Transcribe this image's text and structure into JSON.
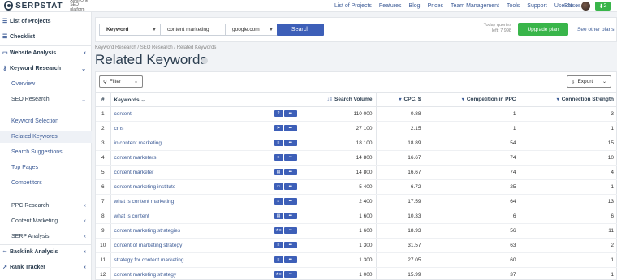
{
  "topbar": {
    "logo": "SERPSTAT",
    "tagline": "All-in-One SEO platform",
    "nav": [
      "List of Projects",
      "Features",
      "Blog",
      "Prices",
      "Team Management",
      "Tools",
      "Support",
      "Use cases"
    ],
    "lang": "EN",
    "notif_count": "2"
  },
  "sidebar": {
    "items": [
      {
        "label": "List of Projects",
        "icon": "list-icon"
      },
      {
        "label": "Checklist",
        "icon": "checklist-icon"
      },
      {
        "label": "Website Analysis",
        "icon": "website-icon"
      },
      {
        "label": "Keyword Research",
        "icon": "key-icon"
      },
      {
        "label": "Overview"
      },
      {
        "label": "SEO Research"
      },
      {
        "label": "Keyword Selection"
      },
      {
        "label": "Related Keywords"
      },
      {
        "label": "Search Suggestions"
      },
      {
        "label": "Top Pages"
      },
      {
        "label": "Competitors"
      },
      {
        "label": "PPC Research"
      },
      {
        "label": "Content Marketing"
      },
      {
        "label": "SERP Analysis"
      },
      {
        "label": "Backlink Analysis",
        "icon": "link-icon"
      },
      {
        "label": "Rank Tracker",
        "icon": "tracker-icon"
      }
    ]
  },
  "search": {
    "type": "Keyword",
    "query": "content marketing",
    "database": "google.com",
    "button": "Search",
    "queries_label": "Today queries",
    "queries_left": "left: 7 998",
    "upgrade": "Upgrade plan",
    "other_plans": "See other plans"
  },
  "page": {
    "breadcrumb": "Keyword Research / SEO Research / Related Keywords",
    "title": "Related Keywords"
  },
  "toolbar": {
    "filter": "Filter",
    "export": "Export"
  },
  "table": {
    "headers": {
      "num": "#",
      "keyword": "Keywords",
      "volume": "Search Volume",
      "cpc": "CPC, $",
      "competition": "Competition in PPC",
      "connection": "Connection Strength"
    },
    "rows": [
      {
        "n": "1",
        "kw": "content",
        "vol": "110 000",
        "cpc": "0.88",
        "comp": "1",
        "conn": "3"
      },
      {
        "n": "2",
        "kw": "cms",
        "vol": "27 100",
        "cpc": "2.15",
        "comp": "1",
        "conn": "1"
      },
      {
        "n": "3",
        "kw": "in content marketing",
        "vol": "18 100",
        "cpc": "18.89",
        "comp": "54",
        "conn": "15"
      },
      {
        "n": "4",
        "kw": "content marketers",
        "vol": "14 800",
        "cpc": "16.67",
        "comp": "74",
        "conn": "10"
      },
      {
        "n": "5",
        "kw": "content marketer",
        "vol": "14 800",
        "cpc": "16.67",
        "comp": "74",
        "conn": "4"
      },
      {
        "n": "6",
        "kw": "content marketing institute",
        "vol": "5 400",
        "cpc": "6.72",
        "comp": "25",
        "conn": "1"
      },
      {
        "n": "7",
        "kw": "what is content marketing",
        "vol": "2 400",
        "cpc": "17.59",
        "comp": "64",
        "conn": "13"
      },
      {
        "n": "8",
        "kw": "what is content",
        "vol": "1 600",
        "cpc": "10.33",
        "comp": "6",
        "conn": "6"
      },
      {
        "n": "9",
        "kw": "content marketing strategies",
        "vol": "1 600",
        "cpc": "18.93",
        "comp": "56",
        "conn": "11"
      },
      {
        "n": "10",
        "kw": "content of marketing strategy",
        "vol": "1 300",
        "cpc": "31.57",
        "comp": "63",
        "conn": "2"
      },
      {
        "n": "11",
        "kw": "strategy for content marketing",
        "vol": "1 300",
        "cpc": "27.05",
        "comp": "60",
        "conn": "1"
      },
      {
        "n": "12",
        "kw": "content marketing strategy",
        "vol": "1 000",
        "cpc": "15.99",
        "comp": "37",
        "conn": "1"
      }
    ]
  }
}
